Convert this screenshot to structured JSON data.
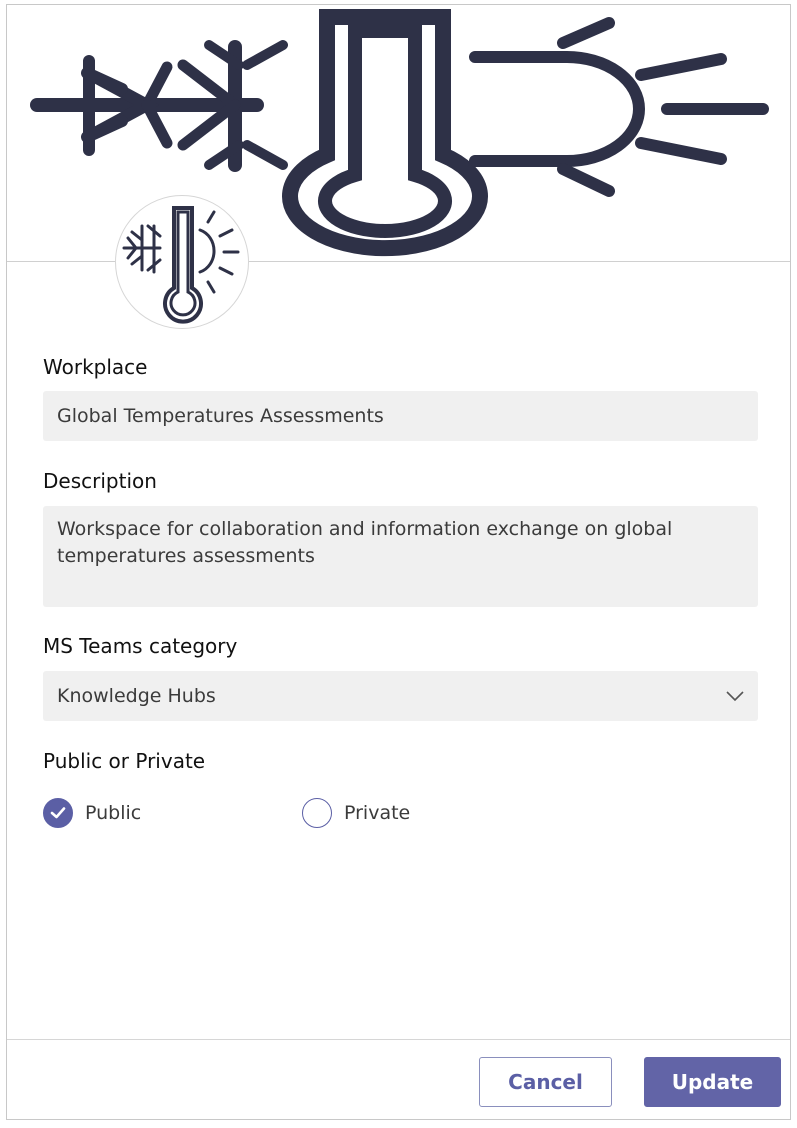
{
  "header": {
    "banner_icon": "snowflake-thermometer-sun-icon",
    "avatar_icon": "snowflake-thermometer-sun-icon"
  },
  "form": {
    "workplace": {
      "label": "Workplace",
      "value": "Global Temperatures Assessments"
    },
    "description": {
      "label": "Description",
      "value": "Workspace for collaboration and information exchange on global temperatures assessments"
    },
    "category": {
      "label": "MS Teams category",
      "value": "Knowledge Hubs",
      "icon": "chevron-down-icon"
    },
    "visibility": {
      "label": "Public or Private",
      "options": [
        {
          "label": "Public",
          "selected": true
        },
        {
          "label": "Private",
          "selected": false
        }
      ]
    }
  },
  "footer": {
    "cancel_label": "Cancel",
    "update_label": "Update"
  },
  "colors": {
    "accent": "#6264a7",
    "icon_stroke": "#2e3147",
    "field_background": "#f0f0f0"
  }
}
